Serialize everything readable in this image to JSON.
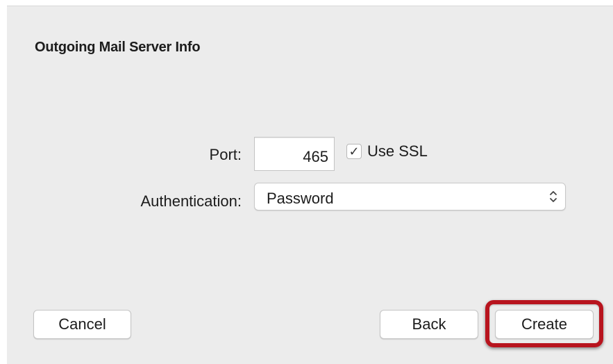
{
  "dialog": {
    "title": "Outgoing Mail Server Info"
  },
  "form": {
    "port_label": "Port:",
    "port_value": "465",
    "use_ssl_label": "Use SSL",
    "use_ssl_checked": true,
    "auth_label": "Authentication:",
    "auth_value": "Password"
  },
  "buttons": {
    "cancel": "Cancel",
    "back": "Back",
    "create": "Create"
  },
  "annotation": {
    "highlight_color": "#b8141e",
    "highlight_target": "create-button"
  },
  "icons": {
    "checkbox_check": "checkmark-icon",
    "select_arrows": "updown-chevron-icon"
  }
}
